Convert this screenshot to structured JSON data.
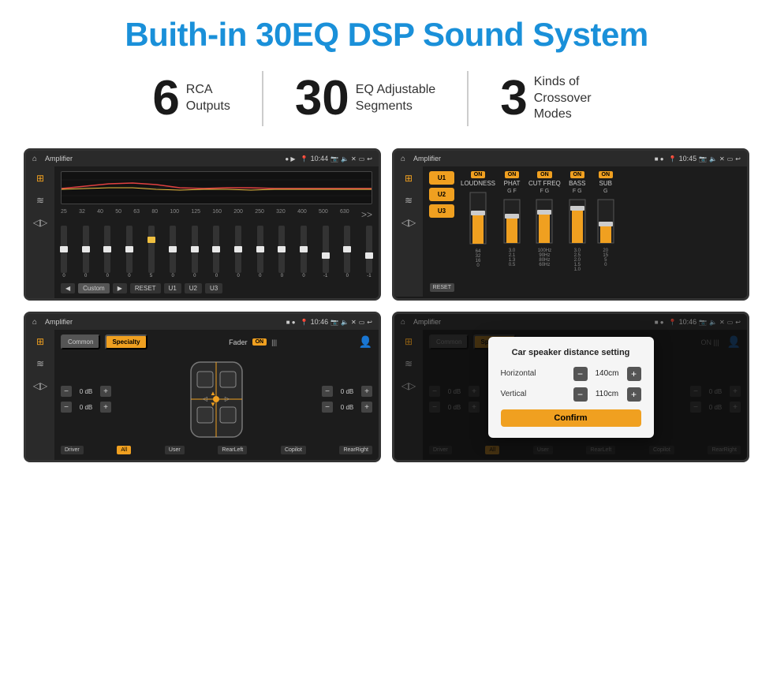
{
  "title": "Buith-in 30EQ DSP Sound System",
  "stats": [
    {
      "number": "6",
      "label": "RCA\nOutputs"
    },
    {
      "number": "30",
      "label": "EQ Adjustable\nSegments"
    },
    {
      "number": "3",
      "label": "Kinds of\nCrossover Modes"
    }
  ],
  "screens": [
    {
      "id": "eq-screen",
      "status_title": "Amplifier",
      "status_time": "10:44",
      "type": "eq"
    },
    {
      "id": "crossover-screen",
      "status_title": "Amplifier",
      "status_time": "10:45",
      "type": "crossover"
    },
    {
      "id": "fader-screen",
      "status_title": "Amplifier",
      "status_time": "10:46",
      "type": "fader"
    },
    {
      "id": "dialog-screen",
      "status_title": "Amplifier",
      "status_time": "10:46",
      "type": "fader-dialog"
    }
  ],
  "eq": {
    "frequencies": [
      "25",
      "32",
      "40",
      "50",
      "63",
      "80",
      "100",
      "125",
      "160",
      "200",
      "250",
      "320",
      "400",
      "500",
      "630"
    ],
    "values": [
      "0",
      "0",
      "0",
      "0",
      "5",
      "0",
      "0",
      "0",
      "0",
      "0",
      "0",
      "0",
      "-1",
      "0",
      "-1"
    ],
    "thumb_positions": [
      50,
      50,
      50,
      50,
      30,
      50,
      50,
      50,
      50,
      50,
      50,
      50,
      65,
      50,
      65
    ],
    "preset": "Custom",
    "buttons": [
      "◀",
      "Custom",
      "▶",
      "RESET",
      "U1",
      "U2",
      "U3"
    ]
  },
  "crossover": {
    "presets": [
      "U1",
      "U2",
      "U3"
    ],
    "channels": [
      "LOUDNESS",
      "PHAT",
      "CUT FREQ",
      "BASS",
      "SUB"
    ],
    "on_labels": [
      "ON",
      "ON",
      "ON",
      "ON",
      "ON"
    ],
    "reset_label": "RESET"
  },
  "fader": {
    "tabs": [
      "Common",
      "Specialty"
    ],
    "active_tab": "Specialty",
    "fader_label": "Fader",
    "on_label": "ON",
    "db_values": [
      "0 dB",
      "0 dB",
      "0 dB",
      "0 dB"
    ],
    "bottom_labels": [
      "Driver",
      "All",
      "User",
      "RearLeft",
      "Copilot",
      "RearRight"
    ],
    "active_bottom": "All"
  },
  "dialog": {
    "title": "Car speaker distance setting",
    "rows": [
      {
        "label": "Horizontal",
        "value": "140cm"
      },
      {
        "label": "Vertical",
        "value": "110cm"
      }
    ],
    "confirm_label": "Confirm",
    "db_values": [
      "0 dB",
      "0 dB"
    ],
    "bottom_labels": [
      "Driver",
      "All",
      "User",
      "RearLeft",
      "Copilot",
      "RearRight"
    ]
  }
}
